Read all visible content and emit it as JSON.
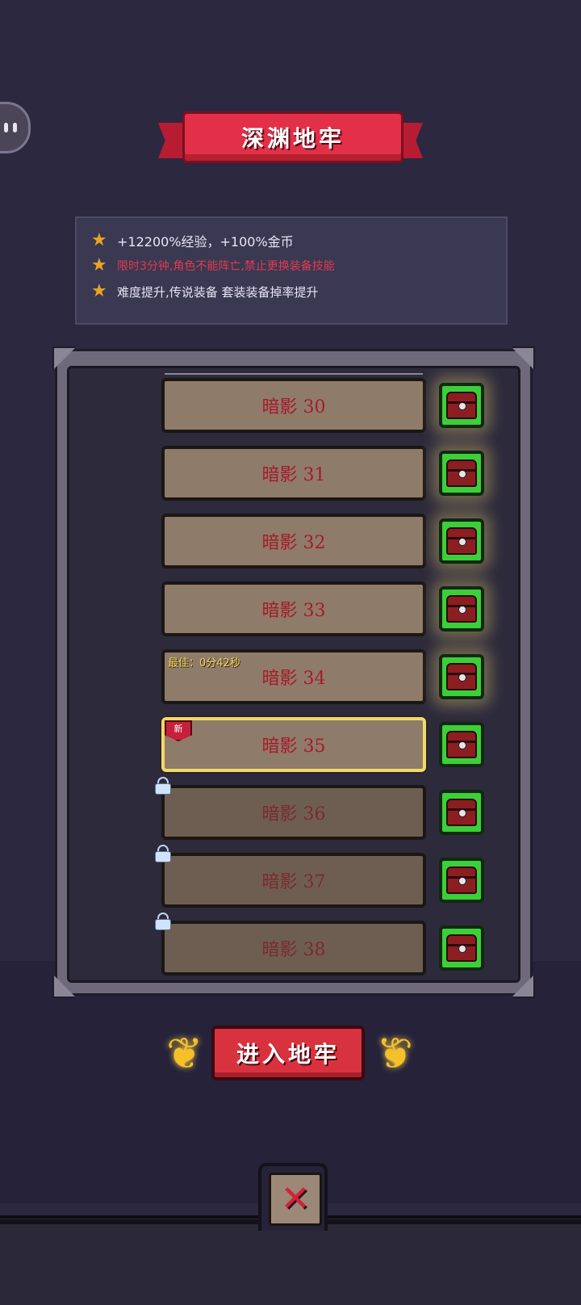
{
  "title": "深渊地牢",
  "info": {
    "rows": [
      {
        "text": "+12200%经验，+100%金币",
        "color": "#e9e4f4"
      },
      {
        "text": "限时3分钟,角色不能阵亡,禁止更换装备技能",
        "color": "#e23a4e"
      },
      {
        "text": "难度提升,传说装备 套装装备掉率提升",
        "color": "#e9e4f4"
      }
    ]
  },
  "levels": [
    {
      "name": "暗影 30",
      "state": "cleared",
      "chest": "claimable"
    },
    {
      "name": "暗影 31",
      "state": "cleared",
      "chest": "claimable"
    },
    {
      "name": "暗影 32",
      "state": "cleared",
      "chest": "claimable"
    },
    {
      "name": "暗影 33",
      "state": "cleared",
      "chest": "claimable"
    },
    {
      "name": "暗影 34",
      "state": "cleared",
      "chest": "claimable",
      "best": "最佳：0分42秒"
    },
    {
      "name": "暗影 35",
      "state": "current",
      "chest": "normal",
      "tag": "新"
    },
    {
      "name": "暗影 36",
      "state": "locked",
      "chest": "normal"
    },
    {
      "name": "暗影 37",
      "state": "locked",
      "chest": "normal"
    },
    {
      "name": "暗影 38",
      "state": "locked",
      "chest": "normal"
    }
  ],
  "enter_button": "进入地牢",
  "close_button": "✕",
  "colors": {
    "background": "#2c2840",
    "accent_red": "#e13048",
    "chest_green": "#3ccf3a",
    "parchment": "#8f7b6a",
    "star": "#e9a524"
  },
  "icons": {
    "info_bullet": "star-icon",
    "reward": "treasure-chest-icon",
    "locked": "padlock-icon",
    "side": "mascot-face-icon"
  }
}
